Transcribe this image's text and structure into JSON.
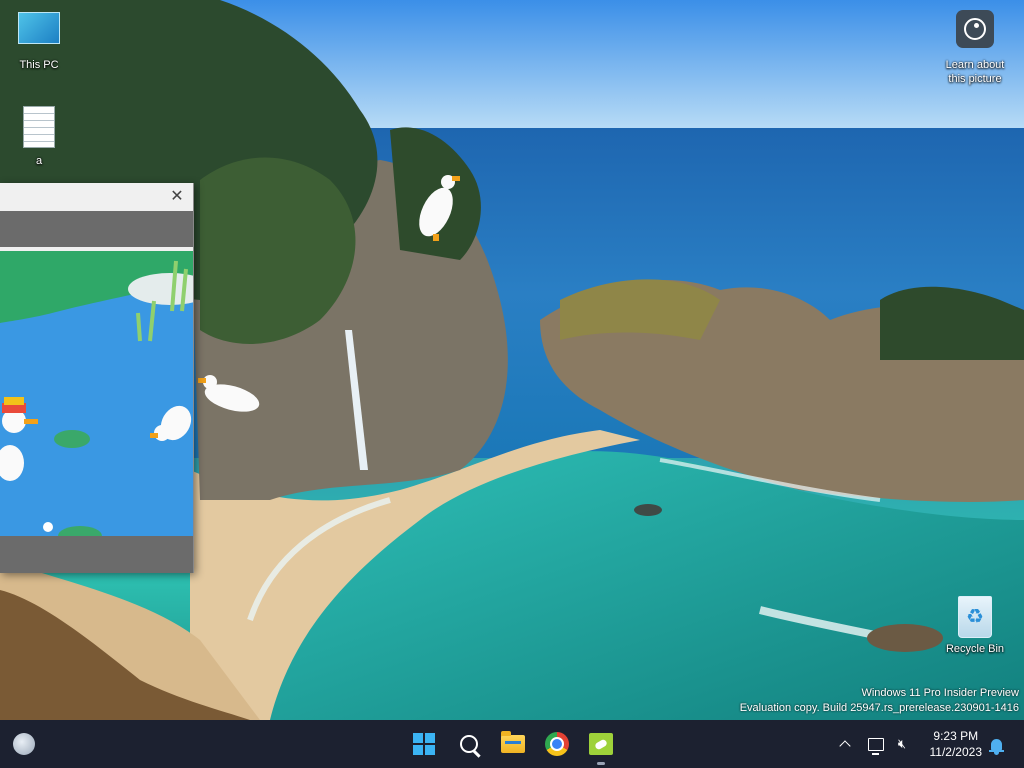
{
  "desktop": {
    "icons": [
      {
        "label": "This PC"
      },
      {
        "label": "a"
      },
      {
        "label": "Recycle Bin"
      }
    ],
    "learn_label_line1": "Learn about",
    "learn_label_line2": "this picture",
    "watermark_line1": "Windows 11 Pro Insider Preview",
    "watermark_line2": "Evaluation copy. Build 25947.rs_prerelease.230901-1416"
  },
  "window": {
    "close_glyph": "✕"
  },
  "taskbar": {
    "time": "9:23 PM",
    "date": "11/2/2023",
    "apps": [
      "start",
      "search",
      "file-explorer",
      "chrome",
      "desktop-goose"
    ]
  }
}
